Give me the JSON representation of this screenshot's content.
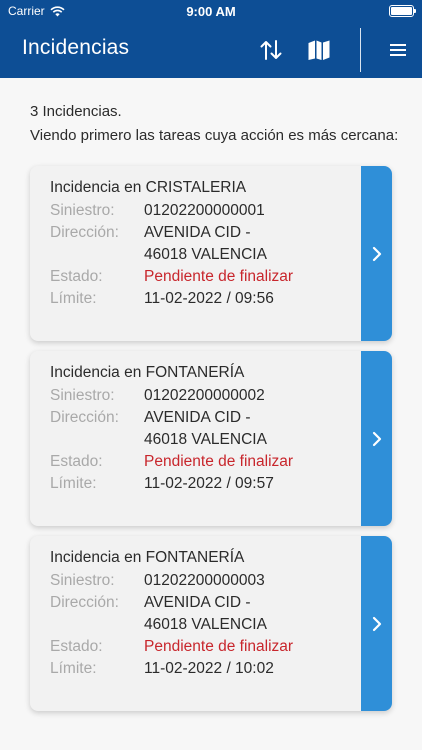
{
  "status_bar": {
    "carrier": "Carrier",
    "time": "9:00 AM"
  },
  "nav": {
    "title": "Incidencias"
  },
  "summary": {
    "count": "3 Incidencias.",
    "order": "Viendo primero las tareas cuya acción es más cercana:"
  },
  "labels": {
    "siniestro": "Siniestro:",
    "direccion": "Dirección:",
    "estado": "Estado:",
    "limite": "Límite:"
  },
  "incidencias": [
    {
      "title": "Incidencia en CRISTALERIA",
      "siniestro": "01202200000001",
      "direccion_1": "AVENIDA CID -",
      "direccion_2": "46018 VALENCIA",
      "estado": "Pendiente de finalizar",
      "limite": "11-02-2022 / 09:56"
    },
    {
      "title": "Incidencia en FONTANERÍA",
      "siniestro": "01202200000002",
      "direccion_1": "AVENIDA CID -",
      "direccion_2": "46018 VALENCIA",
      "estado": "Pendiente de finalizar",
      "limite": "11-02-2022 / 09:57"
    },
    {
      "title": "Incidencia en FONTANERÍA",
      "siniestro": "01202200000003",
      "direccion_1": "AVENIDA CID -",
      "direccion_2": "46018 VALENCIA",
      "estado": "Pendiente de finalizar",
      "limite": "11-02-2022 / 10:02"
    }
  ],
  "colors": {
    "nav_background": "#0d4e95",
    "card_action": "#2f8fd8",
    "status_text": "#c8262c"
  },
  "icons": {
    "sort": "sort-arrows-icon",
    "map": "map-icon",
    "menu": "hamburger-menu-icon",
    "card_action": "chevron-right-icon"
  }
}
